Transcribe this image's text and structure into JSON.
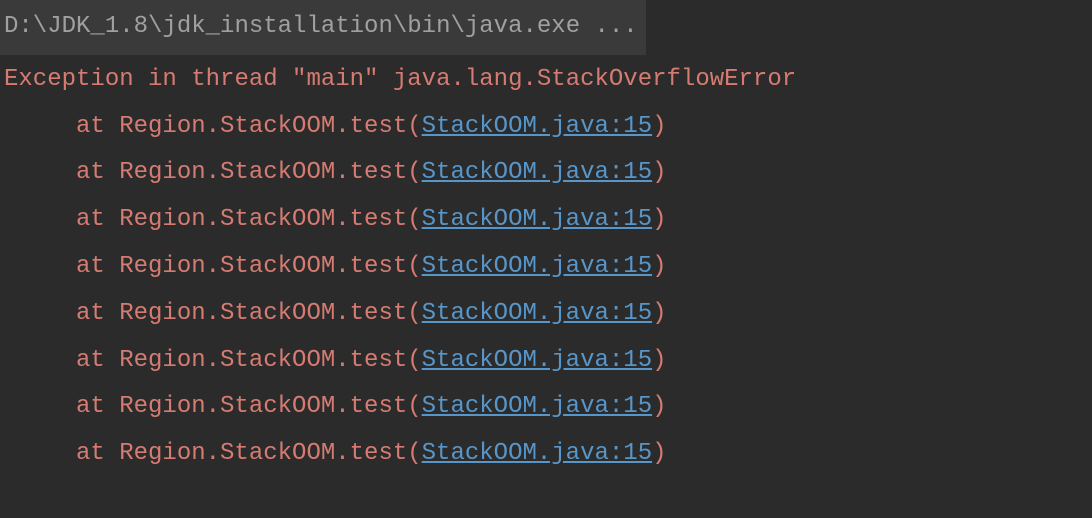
{
  "command": "D:\\JDK_1.8\\jdk_installation\\bin\\java.exe ...",
  "exception": "Exception in thread \"main\" java.lang.StackOverflowError",
  "traces": [
    {
      "prefix": "at Region.StackOOM.test(",
      "link": "StackOOM.java:15",
      "suffix": ")"
    },
    {
      "prefix": "at Region.StackOOM.test(",
      "link": "StackOOM.java:15",
      "suffix": ")"
    },
    {
      "prefix": "at Region.StackOOM.test(",
      "link": "StackOOM.java:15",
      "suffix": ")"
    },
    {
      "prefix": "at Region.StackOOM.test(",
      "link": "StackOOM.java:15",
      "suffix": ")"
    },
    {
      "prefix": "at Region.StackOOM.test(",
      "link": "StackOOM.java:15",
      "suffix": ")"
    },
    {
      "prefix": "at Region.StackOOM.test(",
      "link": "StackOOM.java:15",
      "suffix": ")"
    },
    {
      "prefix": "at Region.StackOOM.test(",
      "link": "StackOOM.java:15",
      "suffix": ")"
    },
    {
      "prefix": "at Region.StackOOM.test(",
      "link": "StackOOM.java:15",
      "suffix": ")"
    }
  ]
}
